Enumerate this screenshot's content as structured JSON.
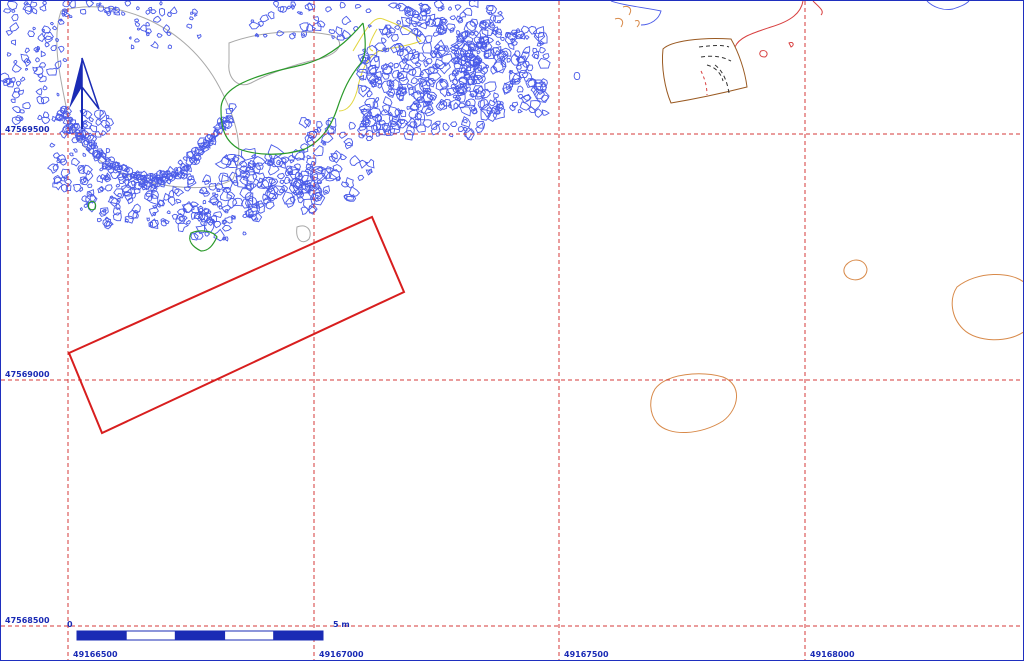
{
  "map": {
    "grid": {
      "y_labels": [
        "47569500",
        "47569000",
        "47568500"
      ],
      "x_labels": [
        "49166500",
        "49167000",
        "49167500",
        "49168000"
      ]
    },
    "scale_bar": {
      "start_label": "0",
      "end_label": "5 m",
      "segments": 5
    },
    "north_arrow": {
      "icon": "north-arrow-icon"
    },
    "colors": {
      "grid": "#d43a3a",
      "stones": "#4a5be8",
      "selection": "#d81e1e",
      "vegetation": "#2a9a2a",
      "gray_outline": "#a8a8a8",
      "yellow_outline": "#e2d640",
      "orange_outline": "#d88a4a",
      "brown_outline": "#9a5a22",
      "frame": "#1f2fbf"
    }
  }
}
